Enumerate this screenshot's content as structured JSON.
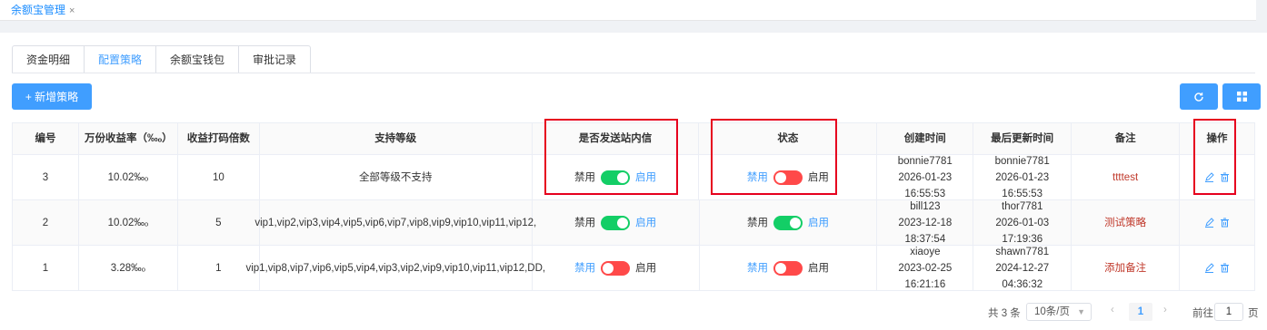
{
  "top_tab": {
    "label": "余额宝管理",
    "close": "×"
  },
  "subtabs": [
    "资金明细",
    "配置策略",
    "余额宝钱包",
    "审批记录"
  ],
  "add_button": "+ 新增策略",
  "table": {
    "headers": [
      "编号",
      "万份收益率（‰ₒ）",
      "收益打码倍数",
      "支持等级",
      "是否发送站内信",
      "状态",
      "创建时间",
      "最后更新时间",
      "备注",
      "操作"
    ],
    "rows": [
      {
        "id": "3",
        "rate": "10.02‰ₒ",
        "multiplier": "10",
        "levels": "全部等级不支持",
        "msg": {
          "off": "禁用",
          "on": "启用",
          "state": "on"
        },
        "status": {
          "off": "禁用",
          "on": "启用",
          "state": "off"
        },
        "created_by": "bonnie7781",
        "created_at": "2026-01-23 16:55:53",
        "updated_by": "bonnie7781",
        "updated_at": "2026-01-23 16:55:53",
        "remark": "ttttest"
      },
      {
        "id": "2",
        "rate": "10.02‰ₒ",
        "multiplier": "5",
        "levels": "vip1,vip2,vip3,vip4,vip5,vip6,vip7,vip8,vip9,vip10,vip11,vip12,",
        "msg": {
          "off": "禁用",
          "on": "启用",
          "state": "on"
        },
        "status": {
          "off": "禁用",
          "on": "启用",
          "state": "on"
        },
        "created_by": "bill123",
        "created_at": "2023-12-18 18:37:54",
        "updated_by": "thor7781",
        "updated_at": "2026-01-03 17:19:36",
        "remark": "测试策略"
      },
      {
        "id": "1",
        "rate": "3.28‰ₒ",
        "multiplier": "1",
        "levels": "vip1,vip8,vip7,vip6,vip5,vip4,vip3,vip2,vip9,vip10,vip11,vip12,DD,",
        "msg": {
          "off": "禁用",
          "on": "启用",
          "state": "off"
        },
        "status": {
          "off": "禁用",
          "on": "启用",
          "state": "off"
        },
        "created_by": "xiaoye",
        "created_at": "2023-02-25 16:21:16",
        "updated_by": "shawn7781",
        "updated_at": "2024-12-27 04:36:32",
        "remark": "添加备注"
      }
    ]
  },
  "pagination": {
    "total": "共 3 条",
    "page_size": "10条/页",
    "current_page": "1",
    "goto_label": "前往",
    "goto_value": "1",
    "unit": "页"
  },
  "colors": {
    "primary": "#409eff",
    "switch_on": "#13ce66",
    "switch_off": "#ff4949",
    "highlight": "#e6001e"
  }
}
